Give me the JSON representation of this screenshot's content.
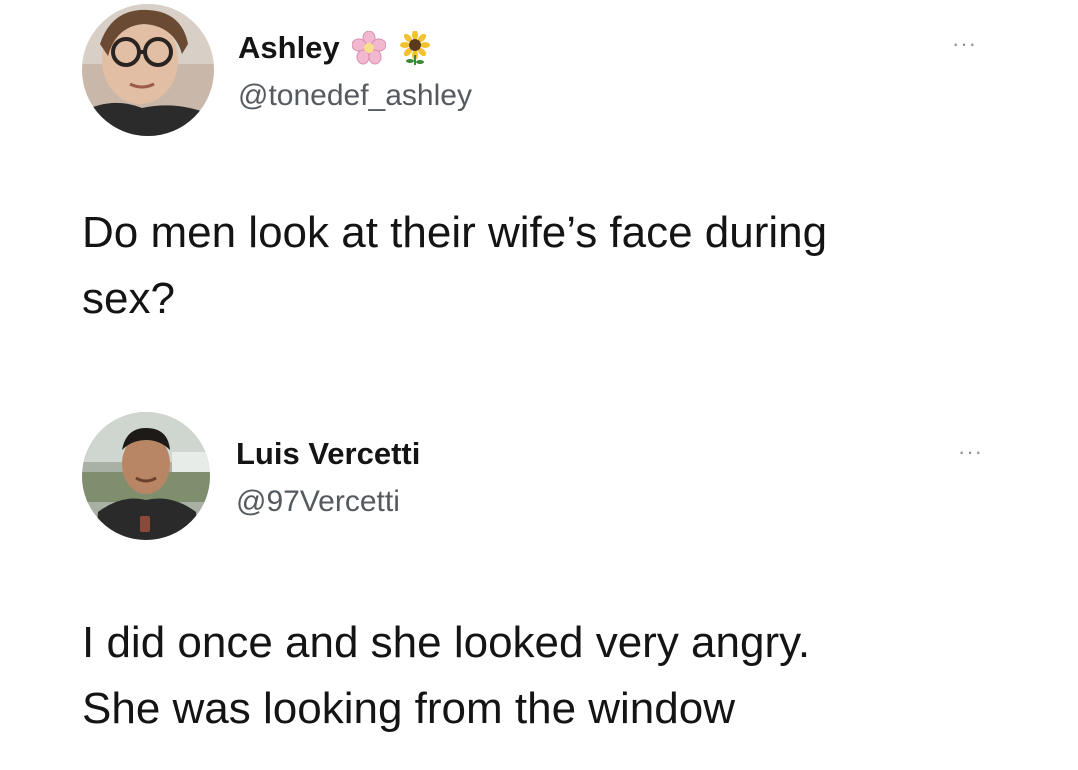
{
  "tweets": [
    {
      "author_name": "Ashley",
      "handle": "@tonedef_ashley",
      "name_emojis": [
        "flower-icon",
        "sunflower-icon"
      ],
      "more_label": "···",
      "text_lines": [
        "Do men look at their wife’s face during",
        "sex?"
      ]
    },
    {
      "author_name": "Luis Vercetti",
      "handle": "@97Vercetti",
      "more_label": "···",
      "text_lines": [
        "I did once and she looked very angry.",
        "She was looking from the window"
      ]
    }
  ],
  "colors": {
    "text": "#141414",
    "handle": "#555a5f",
    "more": "#8b9096",
    "background": "#ffffff"
  }
}
